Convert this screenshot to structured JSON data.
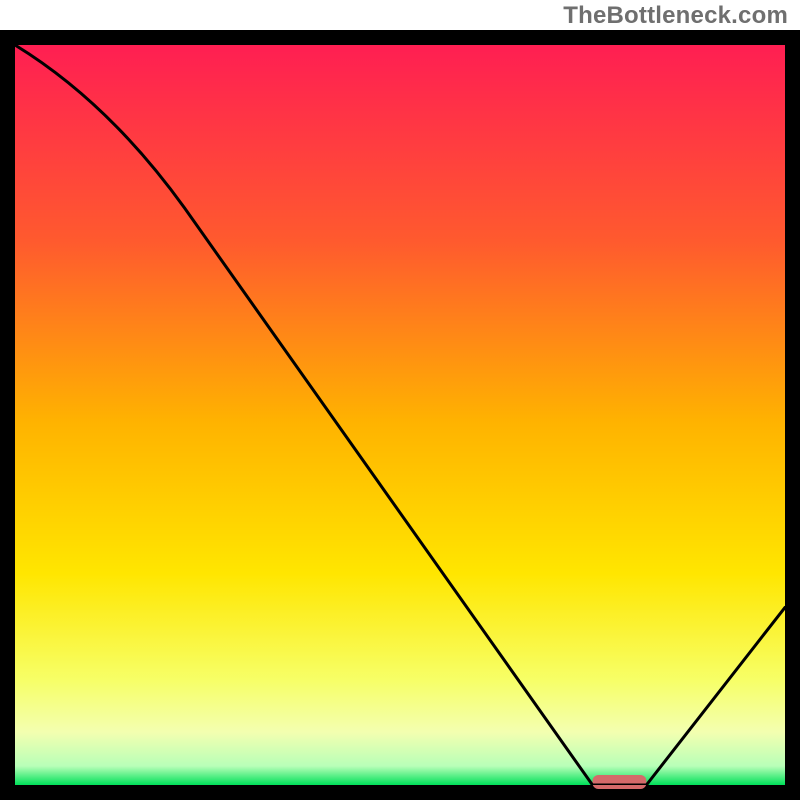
{
  "watermark": "TheBottleneck.com",
  "chart_data": {
    "type": "line",
    "title": "",
    "xlabel": "",
    "ylabel": "",
    "xlim": [
      0,
      100
    ],
    "ylim": [
      0,
      100
    ],
    "x": [
      0,
      22,
      75,
      82,
      100
    ],
    "values": [
      100,
      78,
      0,
      0,
      24
    ],
    "marker": {
      "x_start": 75,
      "x_end": 82,
      "y": 0,
      "color": "#d46a6a"
    },
    "gradient_stops": [
      {
        "offset": 0.0,
        "color": "#ff1a55"
      },
      {
        "offset": 0.28,
        "color": "#ff5a2e"
      },
      {
        "offset": 0.52,
        "color": "#ffb300"
      },
      {
        "offset": 0.72,
        "color": "#ffe600"
      },
      {
        "offset": 0.86,
        "color": "#f7ff66"
      },
      {
        "offset": 0.93,
        "color": "#f3ffb0"
      },
      {
        "offset": 0.975,
        "color": "#b8ffb8"
      },
      {
        "offset": 1.0,
        "color": "#00e05a"
      }
    ],
    "frame_color": "#000000",
    "curve_color": "#000000",
    "curve_width": 3
  }
}
